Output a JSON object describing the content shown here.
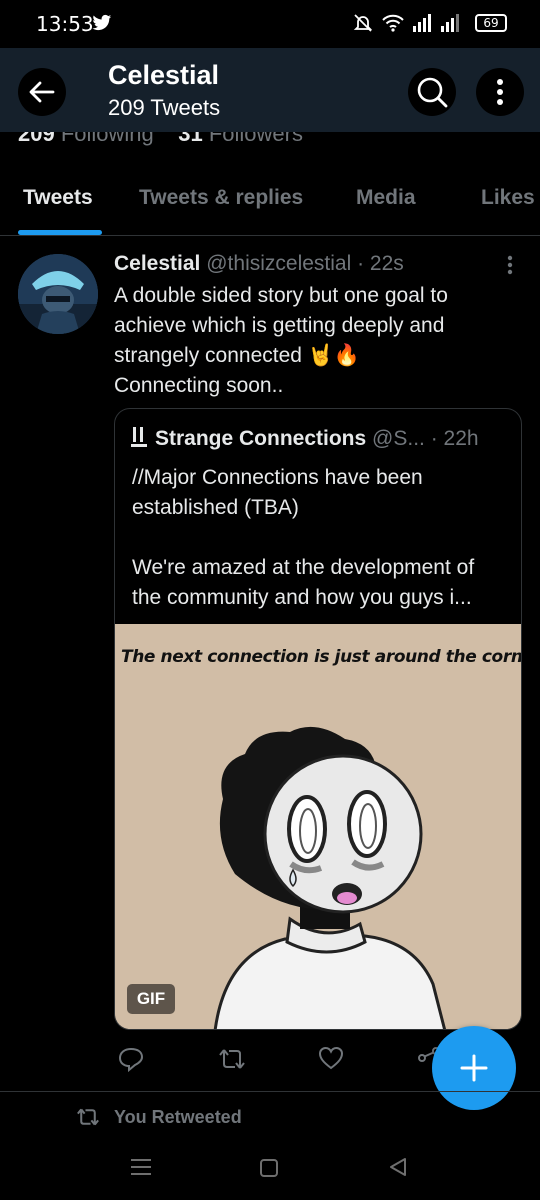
{
  "status_bar": {
    "time": "13:53",
    "battery": "69"
  },
  "profile_peek": {
    "following_count": "209",
    "following_label": "Following",
    "followers_count": "31",
    "followers_label": "Followers"
  },
  "header": {
    "name": "Celestial",
    "tweet_count": "209 Tweets"
  },
  "tabs": [
    {
      "label": "Tweets",
      "active": true
    },
    {
      "label": "Tweets & replies",
      "active": false
    },
    {
      "label": "Media",
      "active": false
    },
    {
      "label": "Likes",
      "active": false
    }
  ],
  "tweet": {
    "name": "Celestial",
    "handle": "@thisizcelestial",
    "time": "· 22s",
    "text_lines": [
      "A double sided story but one goal to",
      "achieve which is getting deeply and",
      "strangely connected 🤘🔥",
      "Connecting soon.."
    ],
    "quote": {
      "name": "Strange Connections",
      "handle": "@S...",
      "time": "· 22h",
      "text_lines": [
        "//Major Connections have been",
        "established (TBA)",
        "",
        "We're amazed at the development of",
        "the community and how you guys i..."
      ],
      "media": {
        "caption": "The next connection is just around the corner...",
        "badge": "GIF"
      }
    }
  },
  "retweet_notice": "You Retweeted",
  "colors": {
    "accent": "#1d9bf0",
    "header_bg": "#15202b",
    "muted_text": "#71767b",
    "media_bg": "#d1bda6"
  }
}
